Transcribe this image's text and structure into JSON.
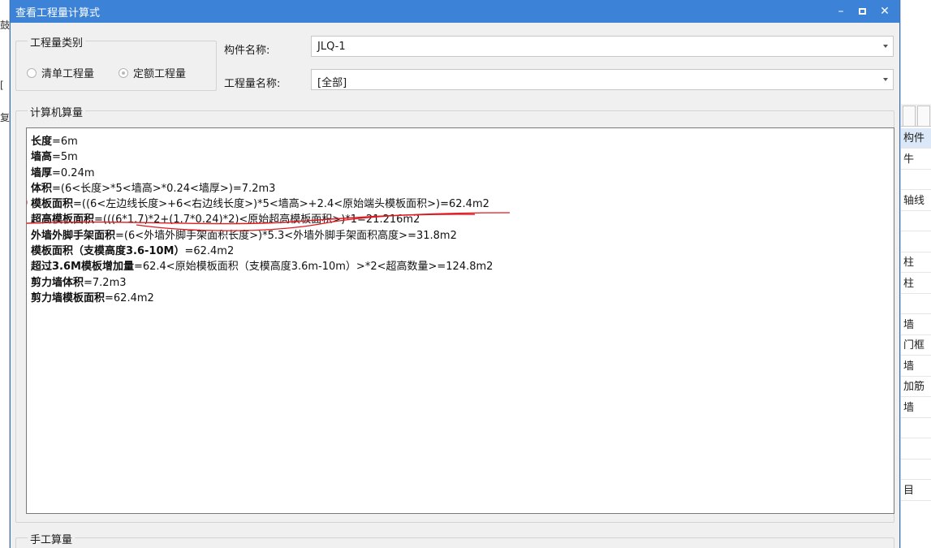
{
  "dialog": {
    "title": "查看工程量计算式",
    "controls": {
      "minimize": "–",
      "maximize": "",
      "close": "✕"
    }
  },
  "quantity_type": {
    "legend": "工程量类别",
    "options": [
      {
        "label": "清单工程量",
        "selected": false
      },
      {
        "label": "定额工程量",
        "selected": true
      }
    ]
  },
  "component": {
    "label": "构件名称:",
    "value": "JLQ-1"
  },
  "quantity_name": {
    "label": "工程量名称:",
    "value": "[全部]"
  },
  "computer_calc": {
    "legend": "计算机算量",
    "lines": [
      {
        "name": "长度",
        "expr": "=6m"
      },
      {
        "name": "墙高",
        "expr": "=5m"
      },
      {
        "name": "墙厚",
        "expr": "=0.24m"
      },
      {
        "name": "体积",
        "expr": "=(6<长度>*5<墙高>*0.24<墙厚>)=7.2m3"
      },
      {
        "name": "模板面积",
        "expr": "=((6<左边线长度>+6<右边线长度>)*5<墙高>+2.4<原始端头模板面积>)=62.4m2"
      },
      {
        "name": "超高模板面积",
        "expr": "=(((6*1.7)*2+(1.7*0.24)*2)<原始超高模板面积>)*1=21.216m2"
      },
      {
        "name": "外墙外脚手架面积",
        "expr": "=(6<外墙外脚手架面积长度>)*5.3<外墙外脚手架面积高度>=31.8m2"
      },
      {
        "name": "模板面积（支模高度3.6-10M）",
        "expr": "=62.4m2"
      },
      {
        "name": "超过3.6M模板增加量",
        "expr": "=62.4<原始模板面积（支模高度3.6m-10m）>*2<超高数量>=124.8m2"
      },
      {
        "name": "剪力墙体积",
        "expr": "=7.2m3"
      },
      {
        "name": "剪力墙模板面积",
        "expr": "=62.4m2"
      }
    ]
  },
  "manual_calc": {
    "legend": "手工算量"
  },
  "background": {
    "left_fragments": [
      "鼓",
      "[",
      "复"
    ],
    "right_cells": [
      "构件",
      "牛",
      "",
      "轴线",
      "",
      "",
      "柱",
      "柱",
      "",
      "墙",
      "门框",
      "墙",
      "加筋",
      "墙",
      "",
      "",
      "",
      "目"
    ]
  },
  "colors": {
    "titlebar": "#3c83d8",
    "annotation": "#e0191f"
  }
}
